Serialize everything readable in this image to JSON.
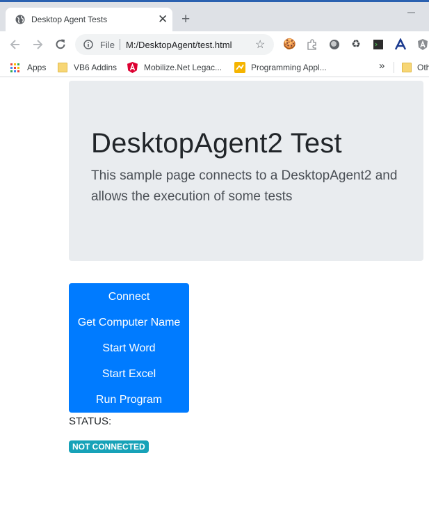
{
  "browser": {
    "tab_title": "Desktop Agent Tests",
    "new_tab_glyph": "+",
    "close_glyph": "✕",
    "scheme": "File",
    "url": "M:/DesktopAgent/test.html",
    "bookmarks": [
      {
        "label": "Apps",
        "icon": "apps-grid-icon"
      },
      {
        "label": "VB6 Addins",
        "icon": "folder-icon"
      },
      {
        "label": "Mobilize.Net Legac...",
        "icon": "angular-icon"
      },
      {
        "label": "Programming Appl...",
        "icon": "bookmark-icon"
      },
      {
        "label": "Oth",
        "icon": "folder-icon"
      }
    ],
    "overflow_glyph": "»"
  },
  "page": {
    "title": "DesktopAgent2 Test",
    "lead": "This sample page connects to a DesktopAgent2 and allows the execution of some tests",
    "buttons": [
      "Connect",
      "Get Computer Name",
      "Start Word",
      "Start Excel",
      "Run Program"
    ],
    "status_label": "STATUS:",
    "status_value": "NOT CONNECTED"
  },
  "colors": {
    "primary": "#007bff",
    "info": "#17a2b8",
    "jumbotron": "#e9ecef"
  }
}
